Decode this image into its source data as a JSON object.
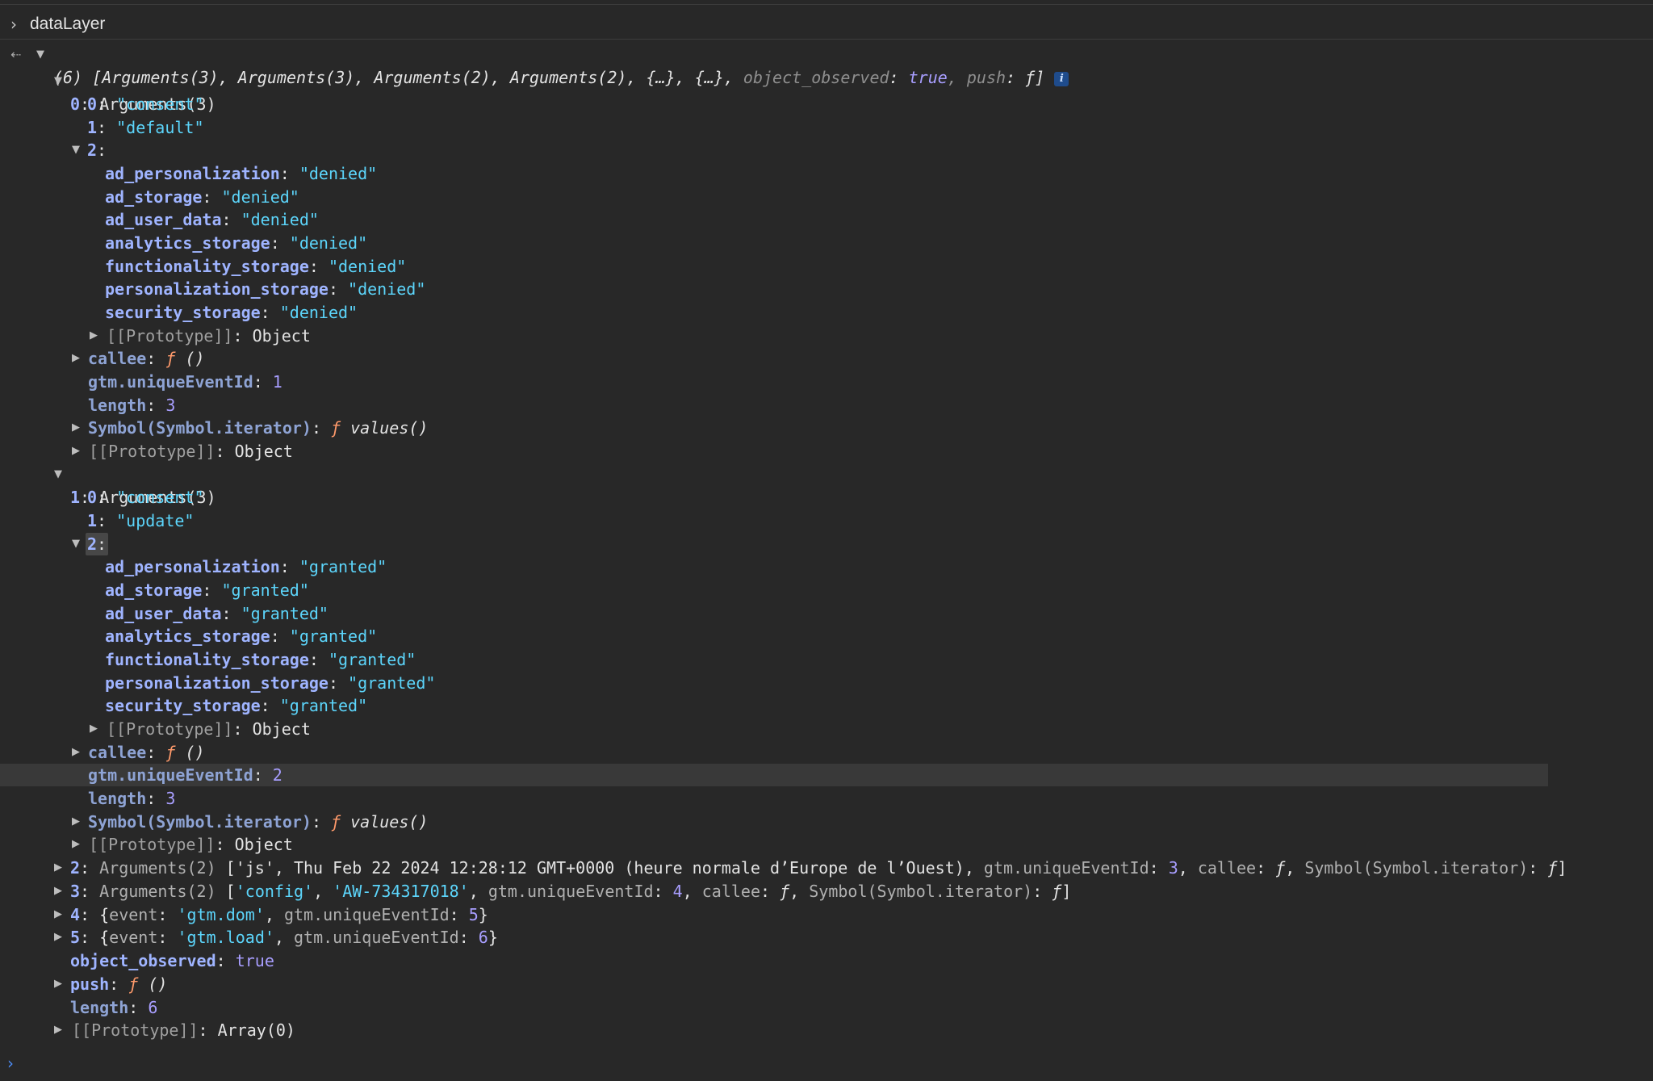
{
  "console": {
    "command": "dataLayer",
    "input_chevron": "›",
    "back_icon": "⇠",
    "prompt_icon": "›",
    "colors": {
      "background": "#282828",
      "key": "#9fb4ff",
      "string": "#5cd5fb",
      "number": "#a89eff",
      "function": "#ff9a6b",
      "highlight": "#393939"
    },
    "summary": {
      "prefix": "(6) [Arguments(3), Arguments(3), Arguments(2), Arguments(2), {…}, {…}, ",
      "obs_key": "object_observed",
      "obs_sep": ": ",
      "obs_val": "true",
      "push_part": ", push",
      "push_sep": ": ",
      "push_val": "ƒ]",
      "info": "i"
    },
    "entry0": {
      "idx": "0",
      "label": "Arguments(3)",
      "arg0": {
        "k": "0",
        "v": "\"consent\""
      },
      "arg1": {
        "k": "1",
        "v": "\"default\""
      },
      "arg2": {
        "k": "2"
      },
      "props": [
        {
          "k": "ad_personalization",
          "v": "\"denied\""
        },
        {
          "k": "ad_storage",
          "v": "\"denied\""
        },
        {
          "k": "ad_user_data",
          "v": "\"denied\""
        },
        {
          "k": "analytics_storage",
          "v": "\"denied\""
        },
        {
          "k": "functionality_storage",
          "v": "\"denied\""
        },
        {
          "k": "personalization_storage",
          "v": "\"denied\""
        },
        {
          "k": "security_storage",
          "v": "\"denied\""
        }
      ],
      "callee": "()",
      "event_id": "1",
      "length": "3"
    },
    "entry1": {
      "idx": "1",
      "label": "Arguments(3)",
      "arg0": {
        "k": "0",
        "v": "\"consent\""
      },
      "arg1": {
        "k": "1",
        "v": "\"update\""
      },
      "arg2": {
        "k": "2"
      },
      "props": [
        {
          "k": "ad_personalization",
          "v": "\"granted\""
        },
        {
          "k": "ad_storage",
          "v": "\"granted\""
        },
        {
          "k": "ad_user_data",
          "v": "\"granted\""
        },
        {
          "k": "analytics_storage",
          "v": "\"granted\""
        },
        {
          "k": "functionality_storage",
          "v": "\"granted\""
        },
        {
          "k": "personalization_storage",
          "v": "\"granted\""
        },
        {
          "k": "security_storage",
          "v": "\"granted\""
        }
      ],
      "callee": "()",
      "event_id": "2",
      "length": "3"
    },
    "labels": {
      "prototype": "[[Prototype]]",
      "object": "Object",
      "array": "Array(0)",
      "callee": "callee",
      "f": "ƒ",
      "event_id_key": "gtm.uniqueEventId",
      "length_key": "length",
      "iterator_key": "Symbol(Symbol.iterator)",
      "values_fn": "values()"
    },
    "entry2": {
      "idx": "2",
      "label": "Arguments(2)",
      "open": " ['js', ",
      "date": "Thu Feb 22 2024 12:28:12 GMT+0000 (heure normale d’Europe de l’Ouest)",
      "event_id": "3",
      "tail_iter": "Symbol(Symbol.iterator)"
    },
    "entry3": {
      "idx": "3",
      "label": "Arguments(2)",
      "s1": "'config'",
      "s2": "'AW-734317018'",
      "event_id": "4"
    },
    "entry4": {
      "idx": "4",
      "event_key": "event",
      "event_val": "'gtm.dom'",
      "event_id": "5"
    },
    "entry5": {
      "idx": "5",
      "event_key": "event",
      "event_val": "'gtm.load'",
      "event_id": "6"
    },
    "tail": {
      "obs_key": "object_observed",
      "obs_val": "true",
      "push_key": "push",
      "push_val": "()",
      "length_key": "length",
      "length_val": "6"
    }
  }
}
